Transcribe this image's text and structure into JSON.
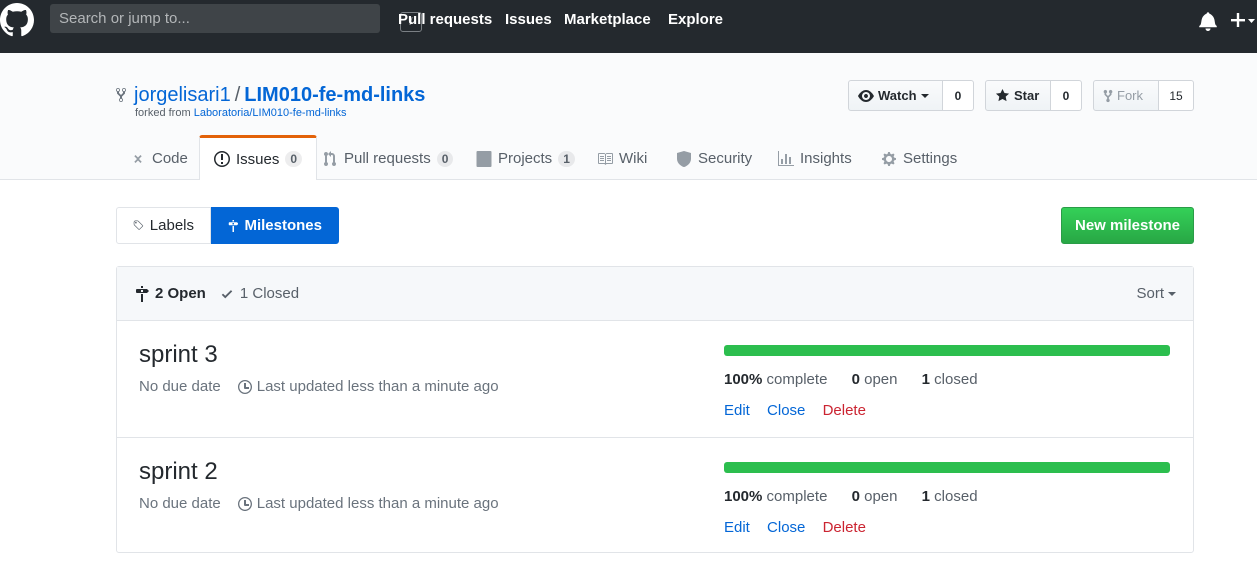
{
  "header": {
    "search_placeholder": "Search or jump to...",
    "slash_key": "/",
    "nav": [
      "Pull requests",
      "Issues",
      "Marketplace",
      "Explore"
    ]
  },
  "repo": {
    "owner": "jorgelisari1",
    "separator": "/",
    "name": "LIM010-fe-md-links",
    "forked_from_prefix": "forked from",
    "forked_from": "Laboratoria/LIM010-fe-md-links",
    "watch_label": "Watch",
    "watch_count": "0",
    "star_label": "Star",
    "star_count": "0",
    "fork_label": "Fork",
    "fork_count": "15"
  },
  "tabs": [
    {
      "label": "Code"
    },
    {
      "label": "Issues",
      "counter": "0"
    },
    {
      "label": "Pull requests",
      "counter": "0"
    },
    {
      "label": "Projects",
      "counter": "1"
    },
    {
      "label": "Wiki"
    },
    {
      "label": "Security"
    },
    {
      "label": "Insights"
    },
    {
      "label": "Settings"
    }
  ],
  "subnav": {
    "labels": "Labels",
    "milestones": "Milestones",
    "new_milestone": "New milestone"
  },
  "milestones_header": {
    "open": "2 Open",
    "closed": "1 Closed",
    "sort": "Sort"
  },
  "milestones": [
    {
      "title": "sprint 3",
      "due": "No due date",
      "updated": "Last updated less than a minute ago",
      "percent_value": 100,
      "percent": "100%",
      "complete_label": "complete",
      "open_count": "0",
      "open_label": "open",
      "closed_count": "1",
      "closed_label": "closed",
      "edit": "Edit",
      "close": "Close",
      "delete": "Delete"
    },
    {
      "title": "sprint 2",
      "due": "No due date",
      "updated": "Last updated less than a minute ago",
      "percent_value": 100,
      "percent": "100%",
      "complete_label": "complete",
      "open_count": "0",
      "open_label": "open",
      "closed_count": "1",
      "closed_label": "closed",
      "edit": "Edit",
      "close": "Close",
      "delete": "Delete"
    }
  ],
  "colors": {
    "header_bg": "#24292e",
    "link": "#0366d6",
    "progress": "#2cbe4e",
    "primary_button": "#28a745",
    "danger": "#cb2431"
  }
}
